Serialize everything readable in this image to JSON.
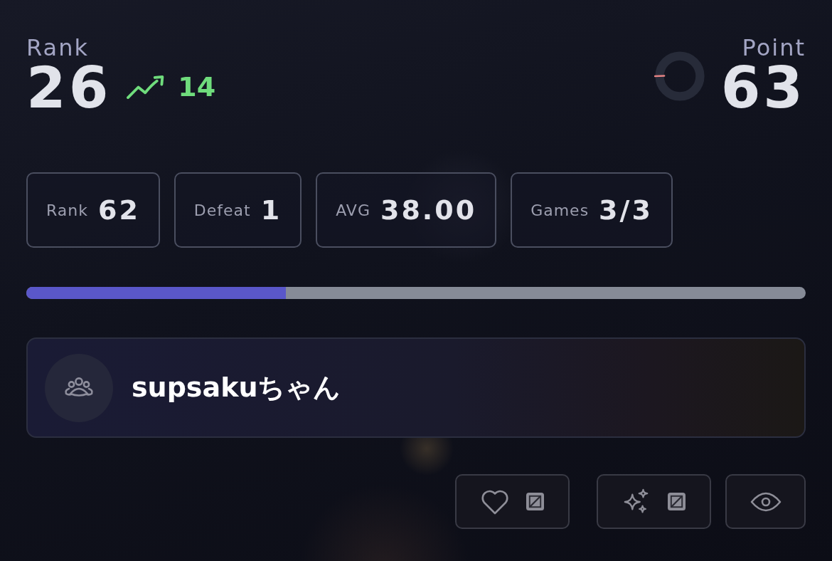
{
  "rank": {
    "label": "Rank",
    "value": "26",
    "change": {
      "value": "14",
      "rising": true
    }
  },
  "point": {
    "label": "Point",
    "value": "63"
  },
  "stats": [
    {
      "label": "Rank",
      "value": "62"
    },
    {
      "label": "Defeat",
      "value": "1"
    },
    {
      "label": "AVG",
      "value": "38.00"
    },
    {
      "label": "Games",
      "value": "3/3"
    }
  ],
  "progress": {
    "level": 0.333
  },
  "profile": {
    "name": "supsakuちゃん"
  },
  "actions": [
    {
      "kind": "like",
      "toggle": true
    },
    {
      "kind": "sparkle",
      "toggle": true
    },
    {
      "kind": "view",
      "toggle": false
    }
  ]
}
